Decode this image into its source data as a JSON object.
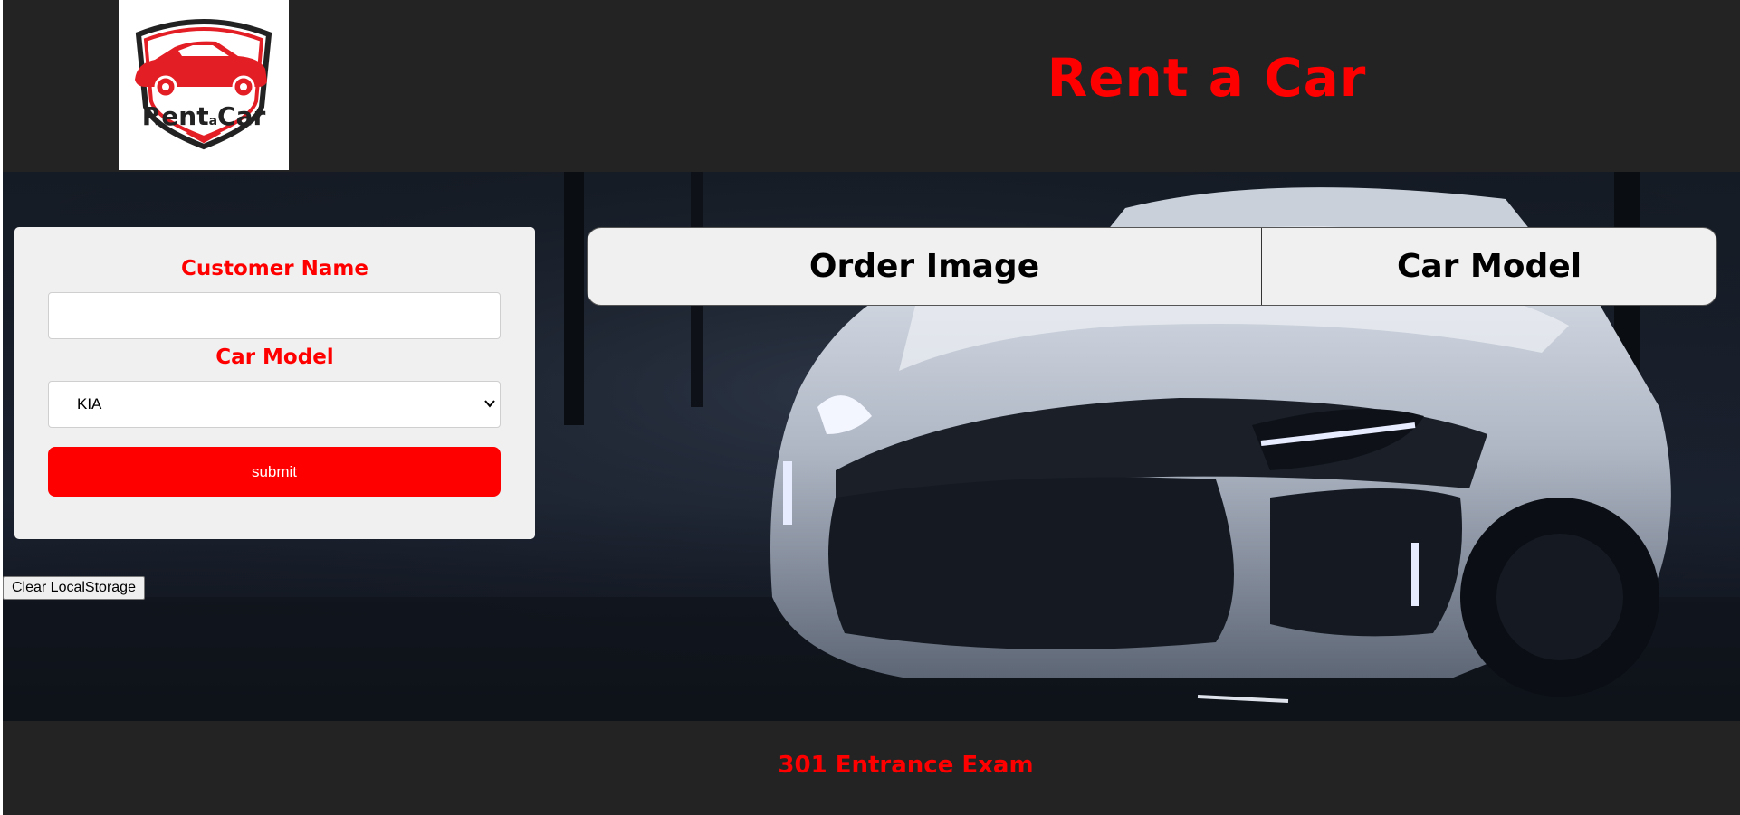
{
  "header": {
    "logo": {
      "text_main": "Rent",
      "text_small": "a",
      "text_end": "Car",
      "icon": "car-logo-icon"
    },
    "title": "Rent a Car"
  },
  "form": {
    "customer_name_label": "Customer Name",
    "customer_name_value": "",
    "car_model_label": "Car Model",
    "car_model_selected": "KIA",
    "submit_label": "submit"
  },
  "clear_storage_label": "Clear LocalStorage",
  "orders_table": {
    "headers": [
      "Order Image",
      "Car Model"
    ]
  },
  "footer": {
    "text": "301 Entrance Exam"
  },
  "colors": {
    "accent": "#ff0000",
    "header_bg": "#232323",
    "card_bg": "#f0f0f0"
  }
}
